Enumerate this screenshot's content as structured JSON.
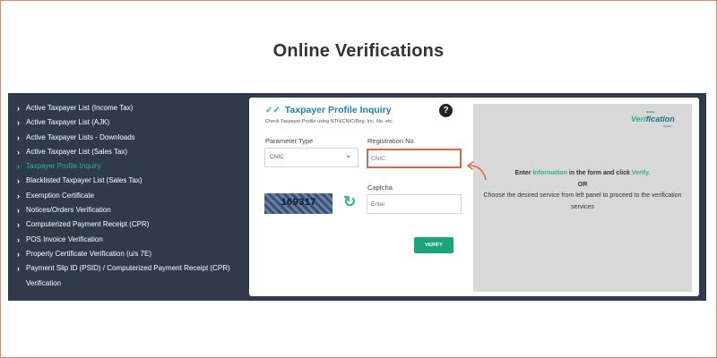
{
  "page": {
    "title": "Online Verifications"
  },
  "sidebar": {
    "items": [
      {
        "label": "Active Taxpayer List (Income Tax)",
        "active": false
      },
      {
        "label": "Active Taxpayer List (AJK)",
        "active": false
      },
      {
        "label": "Active Taxpayer Lists - Downloads",
        "active": false
      },
      {
        "label": "Active Taxpayer List (Sales Tax)",
        "active": false
      },
      {
        "label": "Taxpayer Profile Inquiry",
        "active": true
      },
      {
        "label": "Blacklisted Taxpayer List (Sales Tax)",
        "active": false
      },
      {
        "label": "Exemption Certificate",
        "active": false
      },
      {
        "label": "Notices/Orders Verification",
        "active": false
      },
      {
        "label": "Computerized Payment Receipt (CPR)",
        "active": false
      },
      {
        "label": "POS Invoice Verification",
        "active": false
      },
      {
        "label": "Property Certificate Verification (u/s 7E)",
        "active": false
      },
      {
        "label": "Payment Slip ID (PSID) / Computerized Payment Receipt (CPR)",
        "active": false
      },
      {
        "label": "Verification",
        "active": false,
        "continuation": true
      }
    ]
  },
  "form": {
    "title": "Taxpayer Profile Inquiry",
    "subtitle": "Check Taxpayer Profile using NTN/CNIC/Reg. Inc. No. etc.",
    "parameter_label": "Parameter Type",
    "parameter_value": "CNIC",
    "registration_label": "Registration No.",
    "registration_placeholder": "CNIC",
    "captcha_label": "Captcha",
    "captcha_code": "169317",
    "captcha_placeholder": "Enter",
    "verify_label": "VERIFY",
    "help_symbol": "?"
  },
  "info": {
    "line1_a": "Enter ",
    "line1_b": "Information",
    "line1_c": " in the form and click ",
    "line1_d": "Verify.",
    "line2": "OR",
    "line3": "Choose the desired service from left panel to proceed to the verification services",
    "logo_top": "Online",
    "logo_main_a": "Veri",
    "logo_main_b": "fication",
    "logo_bottom": "System"
  },
  "icons": {
    "chevron": "chevron-right-icon",
    "check": "double-check-icon",
    "help": "question-circle-icon",
    "refresh": "refresh-icon",
    "dropdown": "chevron-down-icon",
    "arrow": "curved-arrow-icon"
  },
  "colors": {
    "panel_bg": "#2f3b4b",
    "accent_green": "#2bb48a",
    "title_blue": "#1f7fae",
    "highlight_orange": "#e2654a",
    "info_bg": "#d8d8d8"
  }
}
